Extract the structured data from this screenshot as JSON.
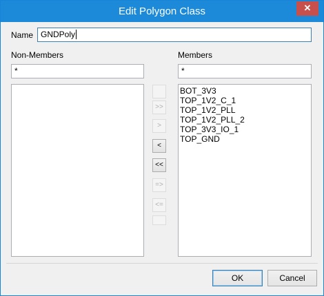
{
  "window": {
    "title": "Edit Polygon Class",
    "close_glyph": "✕"
  },
  "name_field": {
    "label": "Name",
    "value": "GNDPoly"
  },
  "non_members": {
    "header": "Non-Members",
    "filter": "*",
    "items": []
  },
  "members": {
    "header": "Members",
    "filter": "*",
    "items": [
      "BOT_3V3",
      "TOP_1V2_C_1",
      "TOP_1V2_PLL",
      "TOP_1V2_PLL_2",
      "TOP_3V3_IO_1",
      "TOP_GND"
    ]
  },
  "move_buttons": {
    "add_all": ">>",
    "add_one": ">",
    "remove_one": "<",
    "remove_all": "<<",
    "add_selected_icon": "=>",
    "remove_selected_icon": "<="
  },
  "buttons": {
    "ok": "OK",
    "cancel": "Cancel"
  }
}
